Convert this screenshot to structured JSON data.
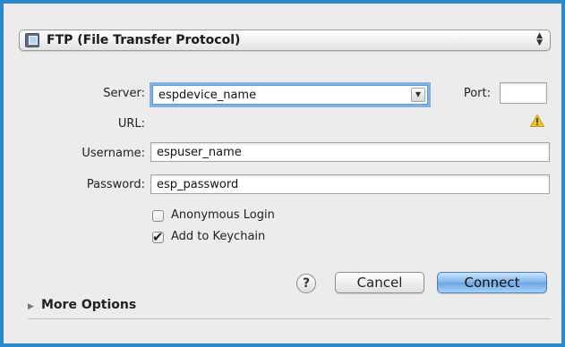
{
  "protocol": {
    "selected": "FTP (File Transfer Protocol)"
  },
  "form": {
    "server_label": "Server:",
    "server_value": "espdevice_name",
    "port_label": "Port:",
    "port_value": "",
    "url_label": "URL:",
    "username_label": "Username:",
    "username_value": "espuser_name",
    "password_label": "Password:",
    "password_value": "esp_password"
  },
  "options": {
    "anonymous_label": "Anonymous Login",
    "anonymous_checked": false,
    "keychain_label": "Add to Keychain",
    "keychain_checked": true
  },
  "buttons": {
    "help": "?",
    "cancel": "Cancel",
    "connect": "Connect"
  },
  "more_options": "More Options",
  "colors": {
    "background": "#2c88c9",
    "sheet": "#ececec",
    "focus": "#5b9ad8",
    "warning": "#f2c230"
  }
}
